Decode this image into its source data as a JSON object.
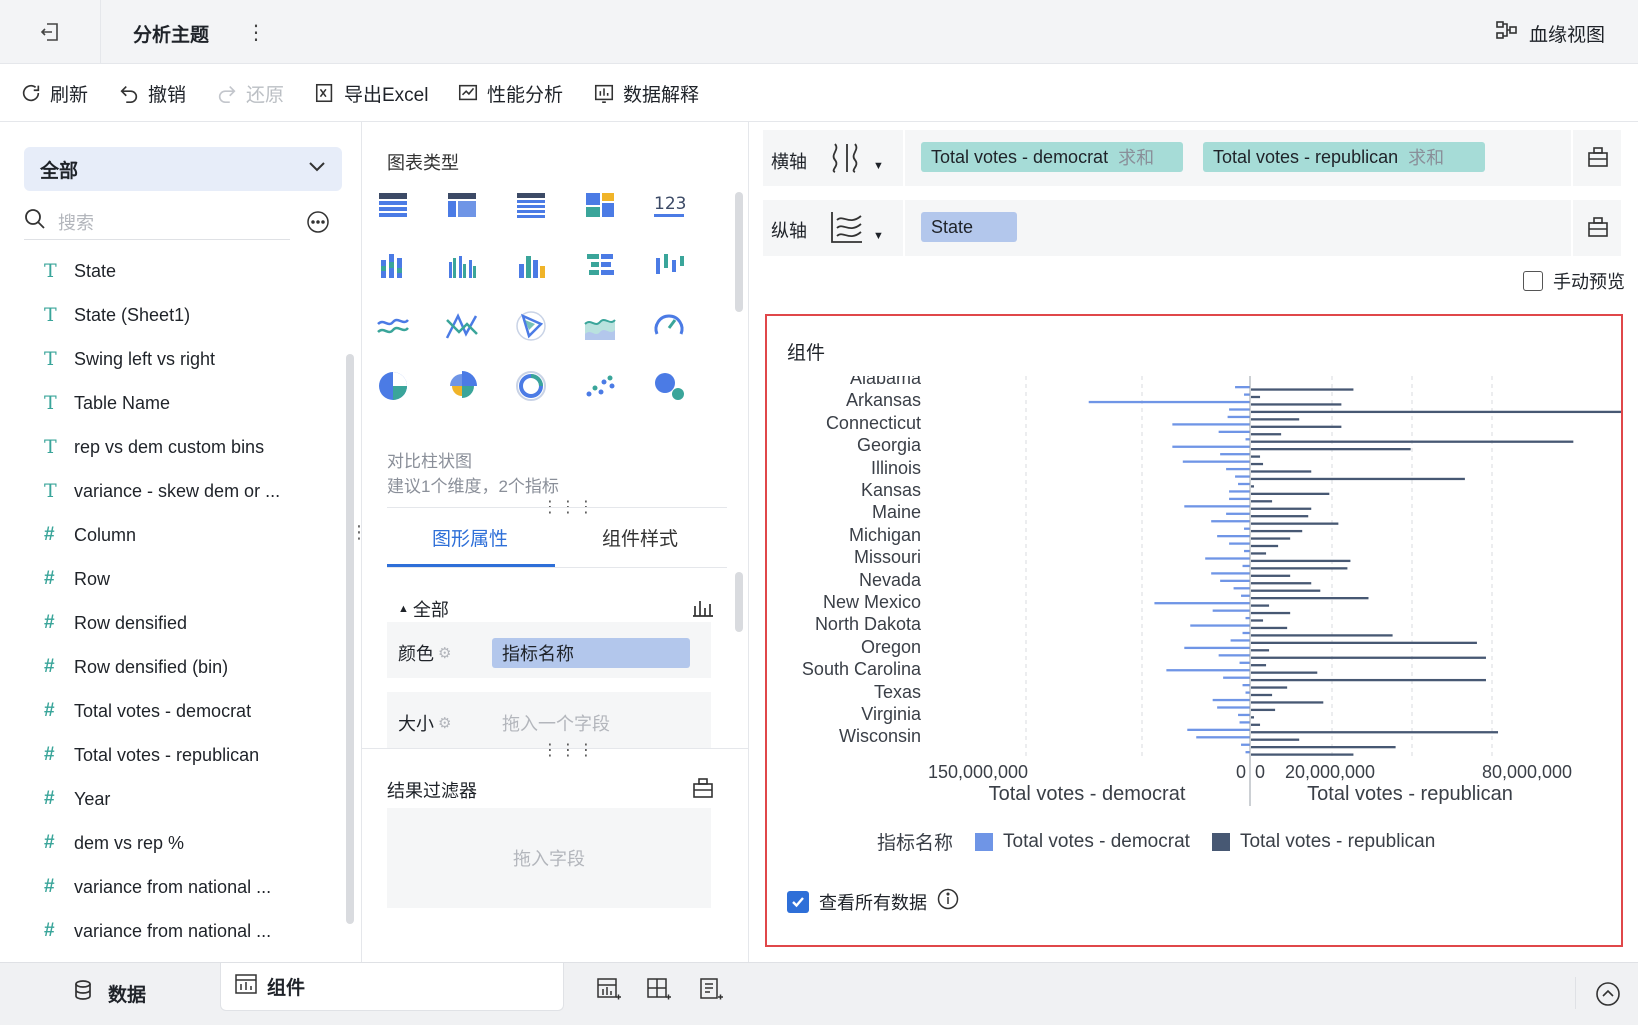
{
  "header": {
    "title": "分析主题",
    "lineage_label": "血缘视图"
  },
  "toolbar": {
    "refresh": "刷新",
    "undo": "撤销",
    "redo": "还原",
    "export": "导出Excel",
    "perf": "性能分析",
    "explain": "数据解释"
  },
  "left": {
    "scope": "全部",
    "search_placeholder": "搜索",
    "fields": [
      {
        "type": "T",
        "name": "State"
      },
      {
        "type": "T",
        "name": "State (Sheet1)"
      },
      {
        "type": "T",
        "name": "Swing left vs right"
      },
      {
        "type": "T",
        "name": "Table Name"
      },
      {
        "type": "T",
        "name": "rep vs dem custom bins"
      },
      {
        "type": "T",
        "name": "variance - skew dem or ..."
      },
      {
        "type": "#",
        "name": "Column"
      },
      {
        "type": "#",
        "name": "Row"
      },
      {
        "type": "#",
        "name": "Row densified"
      },
      {
        "type": "#",
        "name": "Row densified (bin)"
      },
      {
        "type": "#",
        "name": "Total votes - democrat"
      },
      {
        "type": "#",
        "name": "Total votes - republican"
      },
      {
        "type": "#",
        "name": "Year"
      },
      {
        "type": "#",
        "name": "dem vs rep %"
      },
      {
        "type": "#",
        "name": "variance from national ..."
      },
      {
        "type": "#",
        "name": "variance from national ..."
      }
    ]
  },
  "mid": {
    "chart_type_title": "图表类型",
    "chart_name": "对比柱状图",
    "chart_hint": "建议1个维度，2个指标",
    "tab_shape": "图形属性",
    "tab_style": "组件样式",
    "all_label": "全部",
    "color_label": "颜色",
    "color_value": "指标名称",
    "size_label": "大小",
    "size_placeholder": "拖入一个字段",
    "filter_title": "结果过滤器",
    "filter_placeholder": "拖入字段"
  },
  "right": {
    "x_axis_label": "横轴",
    "y_axis_label": "纵轴",
    "x_chips": [
      {
        "name": "Total votes - democrat",
        "agg": "求和"
      },
      {
        "name": "Total votes - republican",
        "agg": "求和"
      }
    ],
    "y_chip": "State",
    "manual_preview": "手动预览",
    "widget_title": "组件",
    "view_all": "查看所有数据",
    "legend_title": "指标名称"
  },
  "bottom": {
    "data_tab": "数据",
    "widget_tab": "组件"
  },
  "colors": {
    "accent": "#2e6fd8",
    "democrat": "#6f95e6",
    "republican": "#475873",
    "teal": "#3aa59a",
    "chip_teal": "#a6dcd7",
    "chip_blue": "#b3c7ec"
  },
  "chart_data": {
    "type": "bar",
    "orientation": "horizontal-diverging",
    "state_labels": [
      "Alabama",
      "Arkansas",
      "Connecticut",
      "Georgia",
      "Illinois",
      "Kansas",
      "Maine",
      "Michigan",
      "Missouri",
      "Nevada",
      "New Mexico",
      "North Dakota",
      "Oregon",
      "South Carolina",
      "Texas",
      "Virginia",
      "Wisconsin"
    ],
    "series": [
      {
        "name": "Total votes - democrat",
        "values": [
          10,
          4,
          108,
          14,
          15,
          52,
          21,
          3,
          52,
          20,
          45,
          16,
          10,
          8,
          14,
          14,
          44,
          16,
          26,
          4,
          22,
          14,
          4,
          30,
          5,
          26,
          20,
          11,
          6,
          64,
          25,
          3,
          40,
          5,
          13,
          44,
          21,
          7,
          56,
          18,
          5,
          3,
          25,
          22,
          8,
          7,
          42,
          36,
          6,
          3
        ]
      },
      {
        "name": "Total votes - republican",
        "values": [
          34,
          3,
          30,
          148,
          16,
          30,
          10,
          107,
          53,
          3,
          4,
          20,
          71,
          1,
          26,
          7,
          20,
          19,
          29,
          17,
          13,
          9,
          5,
          33,
          32,
          13,
          20,
          23,
          39,
          6,
          13,
          4,
          12,
          47,
          75,
          6,
          78,
          5,
          22,
          78,
          12,
          7,
          24,
          8,
          1,
          3,
          82,
          16,
          48,
          34
        ]
      },
      {
        "name": "axis ticks (left)",
        "values": [
          150000000
        ]
      },
      {
        "name": "axis ticks (right)",
        "values": [
          20000000,
          80000000
        ]
      }
    ],
    "xlabel_left": "Total votes - democrat",
    "xlabel_right": "Total votes - republican",
    "left_ticks": [
      "150,000,000",
      "0"
    ],
    "right_ticks": [
      "0",
      "20,000,000",
      "80,000,000"
    ],
    "legend": [
      "Total votes - democrat",
      "Total votes - republican"
    ]
  }
}
